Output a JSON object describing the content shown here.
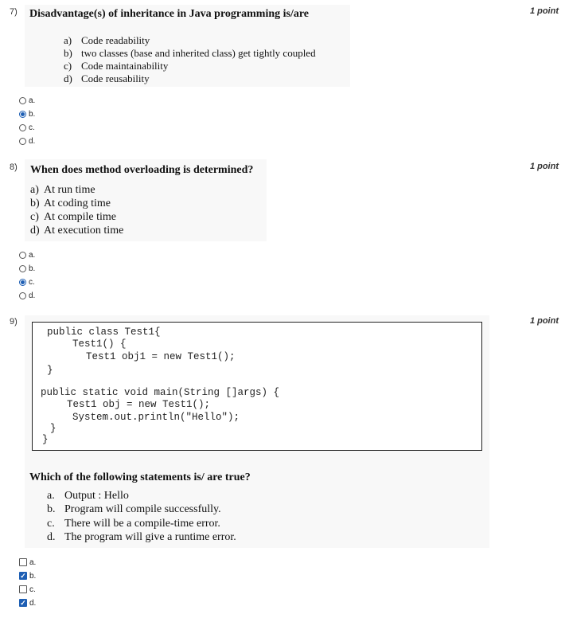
{
  "points_label": "1 point",
  "colors": {
    "accent": "#1e5fb4",
    "question_bg": "#f8f8f8"
  },
  "questions": [
    {
      "number": "7)",
      "title": "Disadvantage(s) of inheritance in Java programming is/are",
      "options": [
        {
          "letter": "a)",
          "text": "Code readability"
        },
        {
          "letter": "b)",
          "text": "two classes (base and inherited class) get tightly coupled"
        },
        {
          "letter": "c)",
          "text": "Code maintainability"
        },
        {
          "letter": "d)",
          "text": "Code reusability"
        }
      ],
      "answers": [
        {
          "label": "a.",
          "selected": false
        },
        {
          "label": "b.",
          "selected": true
        },
        {
          "label": "c.",
          "selected": false
        },
        {
          "label": "d.",
          "selected": false
        }
      ]
    },
    {
      "number": "8)",
      "title": "When does method overloading is determined?",
      "options": [
        {
          "letter": "a)",
          "text": "At run time"
        },
        {
          "letter": "b)",
          "text": "At coding time"
        },
        {
          "letter": "c)",
          "text": "At compile time"
        },
        {
          "letter": "d)",
          "text": "At execution time"
        }
      ],
      "answers": [
        {
          "label": "a.",
          "selected": false
        },
        {
          "label": "b.",
          "selected": false
        },
        {
          "label": "c.",
          "selected": true
        },
        {
          "label": "d.",
          "selected": false
        }
      ]
    },
    {
      "number": "9)",
      "code_lines": [
        "public class Test1{",
        "Test1() {",
        "Test1 obj1 = new Test1();",
        "}",
        "public static void main(String []args) {",
        "Test1 obj = new Test1();",
        "System.out.println(\"Hello\");",
        "}",
        "}"
      ],
      "title": "Which of the following statements is/ are true?",
      "options": [
        {
          "letter": "a.",
          "text": "Output : Hello"
        },
        {
          "letter": "b.",
          "text": "Program will compile successfully."
        },
        {
          "letter": "c.",
          "text": "There will be a compile-time error."
        },
        {
          "letter": "d.",
          "text": "The program will give a runtime error."
        }
      ],
      "answers": [
        {
          "label": "a.",
          "selected": false
        },
        {
          "label": "b.",
          "selected": true
        },
        {
          "label": "c.",
          "selected": false
        },
        {
          "label": "d.",
          "selected": true
        }
      ]
    }
  ]
}
